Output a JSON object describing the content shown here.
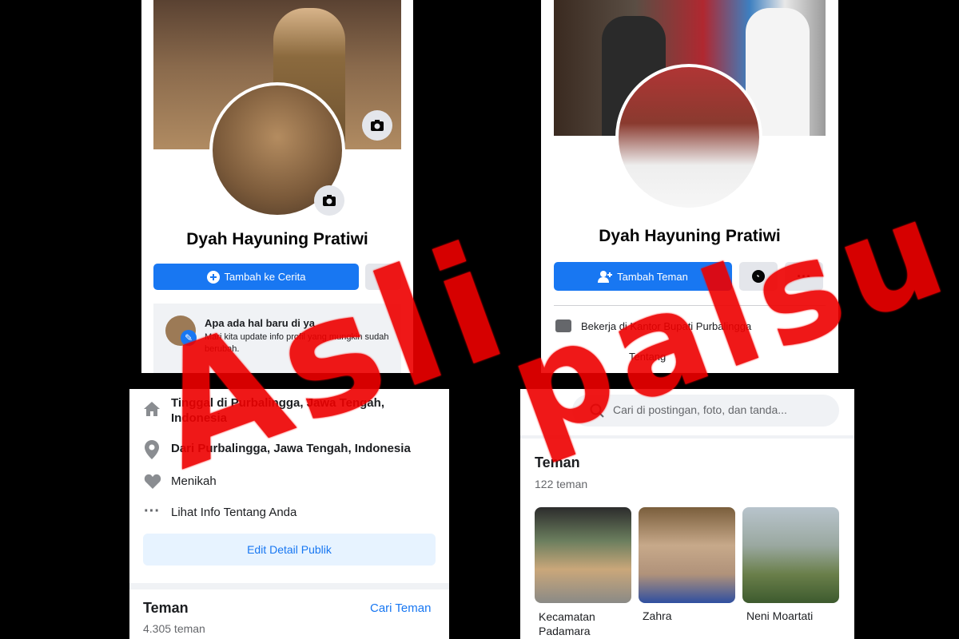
{
  "left_profile": {
    "name": "Dyah Hayuning Pratiwi",
    "primary_button": "Tambah ke Cerita",
    "update_prompt_title": "Apa ada hal baru di ya",
    "update_prompt_text": "Mari kita update info profil yang mungkin sudah berubah."
  },
  "right_profile": {
    "name": "Dyah Hayuning Pratiwi",
    "primary_button": "Tambah Teman",
    "work_text": "Bekerja di Kantor Bupati Purbalingga",
    "about_text": "Tentang"
  },
  "left_info": {
    "lives_in": "Tinggal di Purbalingga, Jawa Tengah, Indonesia",
    "from": "Dari Purbalingga, Jawa Tengah, Indonesia",
    "relationship": "Menikah",
    "see_about": "Lihat Info Tentang Anda",
    "edit_button": "Edit Detail Publik",
    "friends_heading": "Teman",
    "find_friends": "Cari Teman",
    "friends_count": "4.305 teman"
  },
  "right_info": {
    "search_placeholder": "Cari di postingan, foto, dan tanda...",
    "friends_heading": "Teman",
    "friends_count": "122 teman",
    "friends": [
      {
        "name": "Kecamatan Padamara"
      },
      {
        "name": "Zahra"
      },
      {
        "name": "Neni Moartati"
      }
    ]
  },
  "stamps": {
    "left": "Asli",
    "right": "palsu"
  },
  "colors": {
    "facebook_blue": "#1877f2",
    "stamp_red": "#e00000",
    "button_grey": "#e4e6eb"
  }
}
